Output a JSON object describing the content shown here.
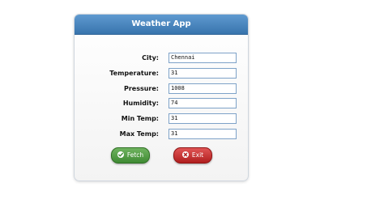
{
  "window": {
    "title": "Weather App"
  },
  "form": {
    "rows": [
      {
        "label": "City:",
        "value": "Chennai"
      },
      {
        "label": "Temperature:",
        "value": "31"
      },
      {
        "label": "Pressure:",
        "value": "1008"
      },
      {
        "label": "Humidity:",
        "value": "74"
      },
      {
        "label": "Min Temp:",
        "value": "31"
      },
      {
        "label": "Max Temp:",
        "value": "31"
      }
    ]
  },
  "buttons": {
    "fetch_label": "Fetch",
    "exit_label": "Exit",
    "fetch_icon": "check-icon",
    "exit_icon": "close-icon"
  },
  "colors": {
    "titlebar": "#3874ad",
    "fetch": "#3f8a33",
    "exit": "#b01e1e"
  }
}
